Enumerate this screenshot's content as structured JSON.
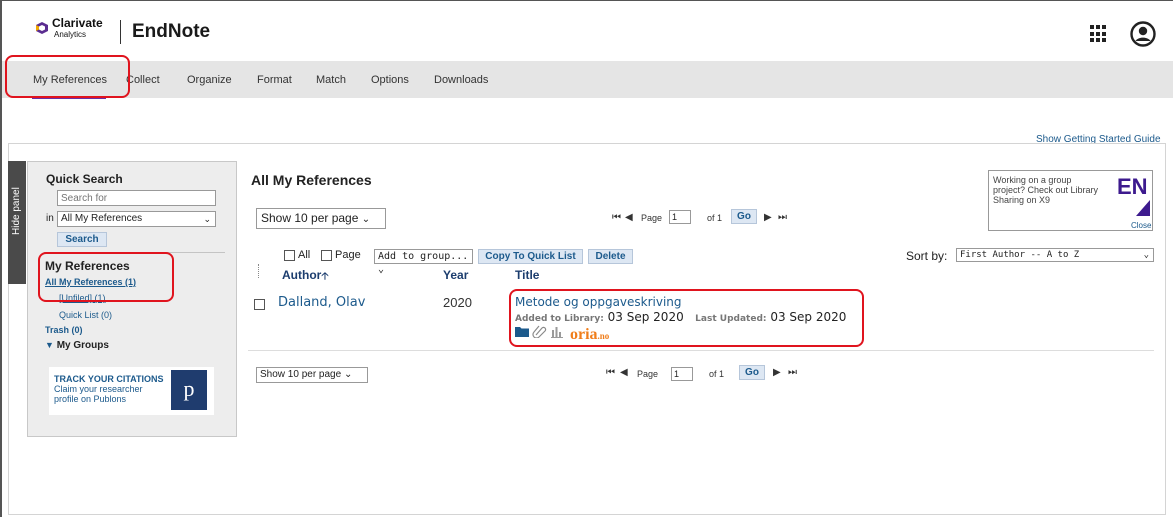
{
  "brand": {
    "company": "Clarivate",
    "company_sub": "Analytics",
    "app_title": "EndNote",
    "accent_color": "#6b2fa8",
    "link_color": "#1c5a8c",
    "highlight_color": "#e0141e"
  },
  "header_icons": [
    "apps-grid-icon",
    "account-icon"
  ],
  "nav": {
    "items": [
      "My References",
      "Collect",
      "Organize",
      "Format",
      "Match",
      "Options",
      "Downloads"
    ],
    "active": "My References"
  },
  "getting_started": "Show Getting Started Guide",
  "hide_panel": "Hide panel",
  "quick_search": {
    "title": "Quick Search",
    "placeholder": "Search for",
    "in_label": "in",
    "scope_value": "All My References",
    "button": "Search"
  },
  "my_references": {
    "title": "My References",
    "items": [
      {
        "label": "All My References (1)"
      },
      {
        "label": "[Unfiled] (1)"
      },
      {
        "label": "Quick List (0)"
      },
      {
        "label": "Trash (0)"
      }
    ],
    "groups": "My Groups"
  },
  "publons": {
    "line1": "TRACK YOUR CITATIONS",
    "line2": "Claim your researcher",
    "line3": "profile on Publons",
    "logo": "p"
  },
  "main": {
    "title": "All My References",
    "per_page": "Show 10 per page",
    "pager": {
      "page_label": "Page",
      "page_value": "1",
      "of_label": "of 1",
      "go": "Go"
    }
  },
  "promo": {
    "text": "Working on a group project? Check out Library Sharing on X9",
    "logo": "EN",
    "close": "Close"
  },
  "toolbar": {
    "all_label": "All",
    "page_label": "Page",
    "add_to_group": "Add to group...",
    "copy_quick_list": "Copy To Quick List",
    "delete": "Delete",
    "sort_label": "Sort by:",
    "sort_value": "First Author -- A to Z"
  },
  "columns": {
    "author": "Author",
    "year": "Year",
    "title": "Title"
  },
  "references": [
    {
      "author": "Dalland, Olav",
      "year": "2020",
      "title": "Metode og oppgaveskriving",
      "added_label": "Added to Library:",
      "added": "03 Sep 2020",
      "updated_label": "Last Updated:",
      "updated": "03 Sep 2020",
      "icons": [
        "folder-icon",
        "attachment-icon",
        "bar-chart-icon"
      ],
      "link_logo": "oria",
      "link_logo_tld": ".no"
    }
  ]
}
